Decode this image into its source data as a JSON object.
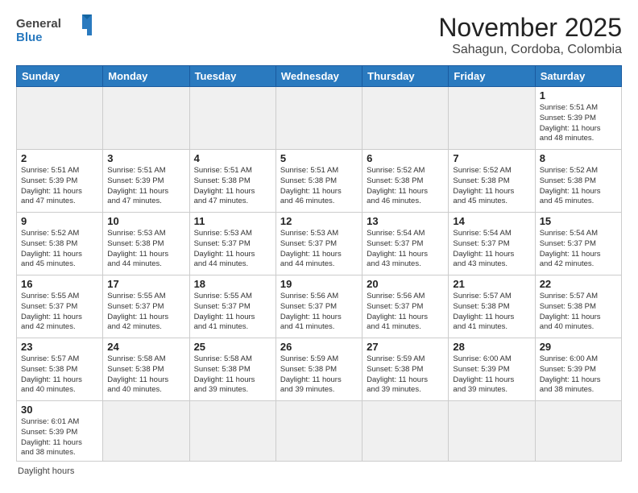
{
  "header": {
    "logo_general": "General",
    "logo_blue": "Blue",
    "month_title": "November 2025",
    "location": "Sahagun, Cordoba, Colombia"
  },
  "weekdays": [
    "Sunday",
    "Monday",
    "Tuesday",
    "Wednesday",
    "Thursday",
    "Friday",
    "Saturday"
  ],
  "weeks": [
    [
      {
        "day": null,
        "info": null
      },
      {
        "day": null,
        "info": null
      },
      {
        "day": null,
        "info": null
      },
      {
        "day": null,
        "info": null
      },
      {
        "day": null,
        "info": null
      },
      {
        "day": null,
        "info": null
      },
      {
        "day": "1",
        "info": "Sunrise: 5:51 AM\nSunset: 5:39 PM\nDaylight: 11 hours\nand 48 minutes."
      }
    ],
    [
      {
        "day": "2",
        "info": "Sunrise: 5:51 AM\nSunset: 5:39 PM\nDaylight: 11 hours\nand 47 minutes."
      },
      {
        "day": "3",
        "info": "Sunrise: 5:51 AM\nSunset: 5:39 PM\nDaylight: 11 hours\nand 47 minutes."
      },
      {
        "day": "4",
        "info": "Sunrise: 5:51 AM\nSunset: 5:38 PM\nDaylight: 11 hours\nand 47 minutes."
      },
      {
        "day": "5",
        "info": "Sunrise: 5:51 AM\nSunset: 5:38 PM\nDaylight: 11 hours\nand 46 minutes."
      },
      {
        "day": "6",
        "info": "Sunrise: 5:52 AM\nSunset: 5:38 PM\nDaylight: 11 hours\nand 46 minutes."
      },
      {
        "day": "7",
        "info": "Sunrise: 5:52 AM\nSunset: 5:38 PM\nDaylight: 11 hours\nand 45 minutes."
      },
      {
        "day": "8",
        "info": "Sunrise: 5:52 AM\nSunset: 5:38 PM\nDaylight: 11 hours\nand 45 minutes."
      }
    ],
    [
      {
        "day": "9",
        "info": "Sunrise: 5:52 AM\nSunset: 5:38 PM\nDaylight: 11 hours\nand 45 minutes."
      },
      {
        "day": "10",
        "info": "Sunrise: 5:53 AM\nSunset: 5:38 PM\nDaylight: 11 hours\nand 44 minutes."
      },
      {
        "day": "11",
        "info": "Sunrise: 5:53 AM\nSunset: 5:37 PM\nDaylight: 11 hours\nand 44 minutes."
      },
      {
        "day": "12",
        "info": "Sunrise: 5:53 AM\nSunset: 5:37 PM\nDaylight: 11 hours\nand 44 minutes."
      },
      {
        "day": "13",
        "info": "Sunrise: 5:54 AM\nSunset: 5:37 PM\nDaylight: 11 hours\nand 43 minutes."
      },
      {
        "day": "14",
        "info": "Sunrise: 5:54 AM\nSunset: 5:37 PM\nDaylight: 11 hours\nand 43 minutes."
      },
      {
        "day": "15",
        "info": "Sunrise: 5:54 AM\nSunset: 5:37 PM\nDaylight: 11 hours\nand 42 minutes."
      }
    ],
    [
      {
        "day": "16",
        "info": "Sunrise: 5:55 AM\nSunset: 5:37 PM\nDaylight: 11 hours\nand 42 minutes."
      },
      {
        "day": "17",
        "info": "Sunrise: 5:55 AM\nSunset: 5:37 PM\nDaylight: 11 hours\nand 42 minutes."
      },
      {
        "day": "18",
        "info": "Sunrise: 5:55 AM\nSunset: 5:37 PM\nDaylight: 11 hours\nand 41 minutes."
      },
      {
        "day": "19",
        "info": "Sunrise: 5:56 AM\nSunset: 5:37 PM\nDaylight: 11 hours\nand 41 minutes."
      },
      {
        "day": "20",
        "info": "Sunrise: 5:56 AM\nSunset: 5:37 PM\nDaylight: 11 hours\nand 41 minutes."
      },
      {
        "day": "21",
        "info": "Sunrise: 5:57 AM\nSunset: 5:38 PM\nDaylight: 11 hours\nand 41 minutes."
      },
      {
        "day": "22",
        "info": "Sunrise: 5:57 AM\nSunset: 5:38 PM\nDaylight: 11 hours\nand 40 minutes."
      }
    ],
    [
      {
        "day": "23",
        "info": "Sunrise: 5:57 AM\nSunset: 5:38 PM\nDaylight: 11 hours\nand 40 minutes."
      },
      {
        "day": "24",
        "info": "Sunrise: 5:58 AM\nSunset: 5:38 PM\nDaylight: 11 hours\nand 40 minutes."
      },
      {
        "day": "25",
        "info": "Sunrise: 5:58 AM\nSunset: 5:38 PM\nDaylight: 11 hours\nand 39 minutes."
      },
      {
        "day": "26",
        "info": "Sunrise: 5:59 AM\nSunset: 5:38 PM\nDaylight: 11 hours\nand 39 minutes."
      },
      {
        "day": "27",
        "info": "Sunrise: 5:59 AM\nSunset: 5:38 PM\nDaylight: 11 hours\nand 39 minutes."
      },
      {
        "day": "28",
        "info": "Sunrise: 6:00 AM\nSunset: 5:39 PM\nDaylight: 11 hours\nand 39 minutes."
      },
      {
        "day": "29",
        "info": "Sunrise: 6:00 AM\nSunset: 5:39 PM\nDaylight: 11 hours\nand 38 minutes."
      }
    ],
    [
      {
        "day": "30",
        "info": "Sunrise: 6:01 AM\nSunset: 5:39 PM\nDaylight: 11 hours\nand 38 minutes."
      },
      {
        "day": null,
        "info": null
      },
      {
        "day": null,
        "info": null
      },
      {
        "day": null,
        "info": null
      },
      {
        "day": null,
        "info": null
      },
      {
        "day": null,
        "info": null
      },
      {
        "day": null,
        "info": null
      }
    ]
  ],
  "footer": {
    "daylight_label": "Daylight hours"
  }
}
